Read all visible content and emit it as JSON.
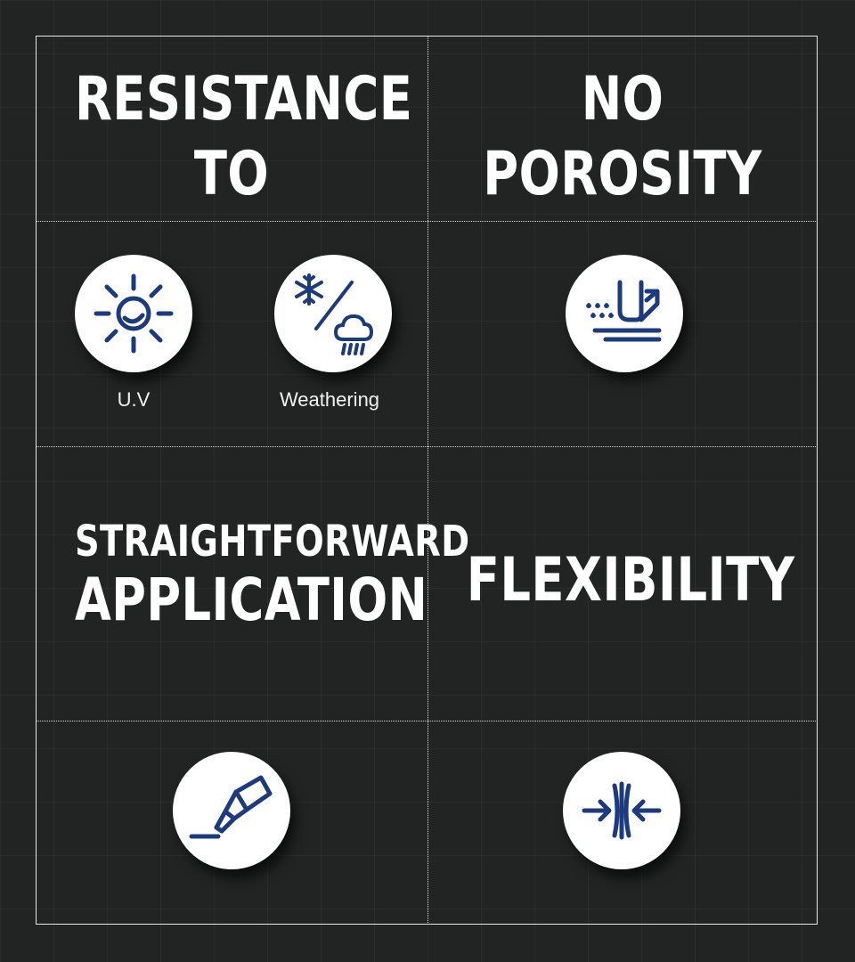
{
  "panels": {
    "resistance": {
      "title_line1": "RESISTANCE",
      "title_line2": "TO",
      "icons": [
        {
          "icon": "sun-uv-icon",
          "label": "U.V"
        },
        {
          "icon": "snow-rain-weather-icon",
          "label": "Weathering"
        }
      ]
    },
    "porosity": {
      "title_line1": "NO",
      "title_line2": "POROSITY",
      "icon": "water-repellent-surface-icon"
    },
    "application": {
      "title_line1": "STRAIGHTFORWARD",
      "title_line2": "APPLICATION",
      "icon": "sealant-tube-icon"
    },
    "flexibility": {
      "title": "FLEXIBILITY",
      "icon": "compression-arrows-icon"
    }
  },
  "colors": {
    "background": "#222424",
    "icon_blue": "#1c3a7e",
    "circle_fill": "#ffffff",
    "text": "#ffffff",
    "frame": "#e8e8e8"
  }
}
